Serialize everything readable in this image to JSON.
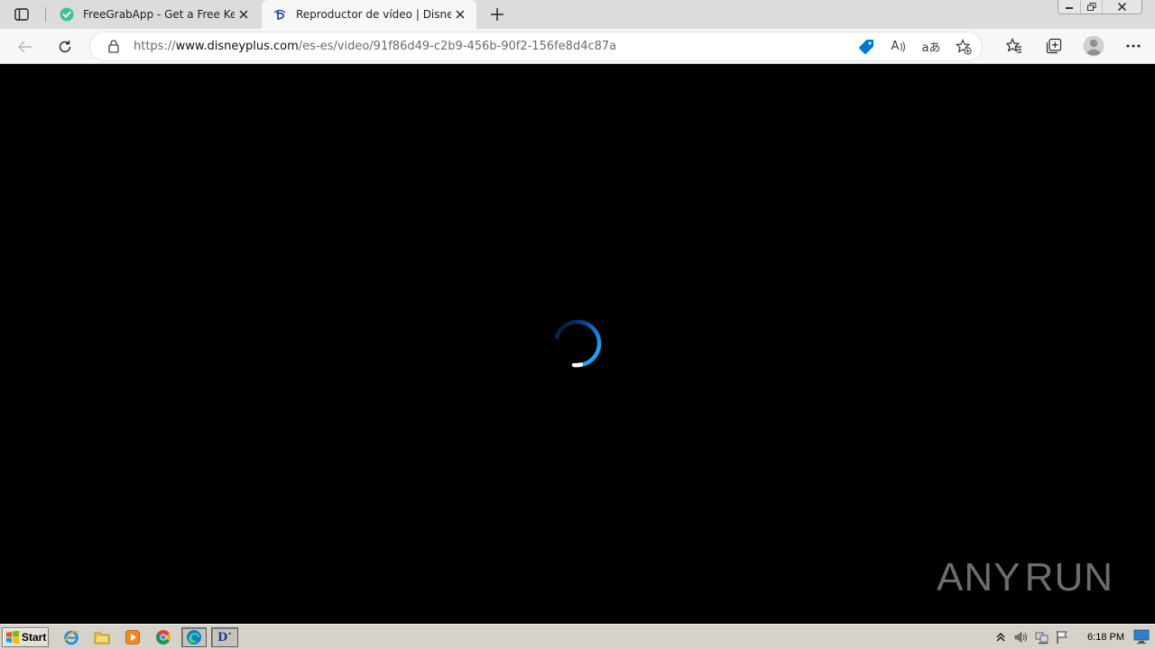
{
  "browser": {
    "tabs": [
      {
        "title": "FreeGrabApp - Get a Free Key",
        "favicon": "freegrabapp-favicon",
        "active": false
      },
      {
        "title": "Reproductor de vídeo | Disney+",
        "favicon": "disney-favicon",
        "active": true
      }
    ],
    "address": {
      "scheme": "https://",
      "host": "www.disneyplus.com",
      "path": "/es-es/video/91f86d49-c2b9-456b-90f2-156fe8d4c87a"
    },
    "omnibox_icons": [
      "shopping-tag-icon",
      "read-aloud-icon",
      "translate-icon",
      "add-favorite-icon"
    ],
    "read_aloud_glyph": "A",
    "translate_glyph": "aあ",
    "toolbar_icons": [
      "favorites-icon",
      "collections-icon",
      "profile-icon",
      "more-icon"
    ]
  },
  "player": {
    "state": "loading",
    "spinner_colors": [
      "#0a3f8c",
      "#1aa3f0",
      "#ffffff"
    ]
  },
  "watermark": {
    "left": "ANY",
    "right": "RUN"
  },
  "taskbar": {
    "start_label": "Start",
    "quick_launch": [
      "internet-explorer-icon",
      "file-explorer-icon",
      "media-player-icon",
      "chrome-icon",
      "edge-icon",
      "disney-plus-icon"
    ],
    "disney_label": "D",
    "clock": "6:18 PM"
  },
  "colors": {
    "accent_blue": "#0078d4",
    "disney_blue": "#1a3c94",
    "tab_strip": "#dcdcdc",
    "toolbar": "#f7f7f7",
    "taskbar": "#d6d2c9"
  }
}
